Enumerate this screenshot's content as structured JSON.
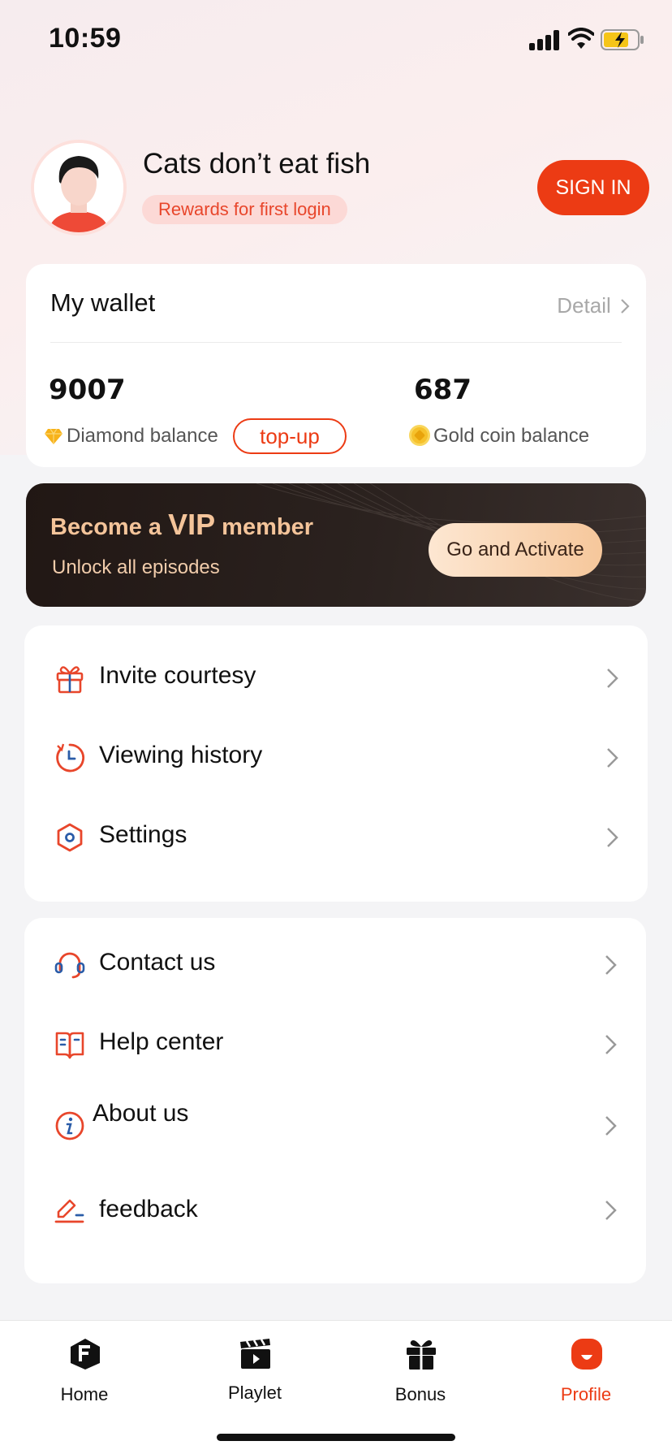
{
  "status_bar": {
    "time": "10:59"
  },
  "profile": {
    "username": "Cats don’t eat fish",
    "reward_badge": "Rewards for first login",
    "sign_in_label": "SIGN IN"
  },
  "wallet": {
    "title": "My wallet",
    "detail_label": "Detail",
    "diamond_balance": "9007",
    "diamond_label": "Diamond balance",
    "topup_label": "top-up",
    "gold_balance": "687",
    "gold_label": "Gold coin balance"
  },
  "vip": {
    "title_pre": "Become a",
    "title_vip": "VIP",
    "title_post": "member",
    "subtitle": "Unlock all episodes",
    "button_label": "Go and Activate"
  },
  "menu_primary": [
    {
      "label": "Invite courtesy",
      "icon": "gift-icon"
    },
    {
      "label": "Viewing history",
      "icon": "history-icon"
    },
    {
      "label": "Settings",
      "icon": "settings-icon"
    }
  ],
  "menu_secondary": [
    {
      "label": "Contact us",
      "icon": "headset-icon"
    },
    {
      "label": "Help center",
      "icon": "book-icon"
    },
    {
      "label": "About us",
      "icon": "info-icon"
    },
    {
      "label": "feedback",
      "icon": "edit-icon"
    }
  ],
  "bottom_nav": [
    {
      "label": "Home",
      "icon": "home-icon",
      "active": false
    },
    {
      "label": "Playlet",
      "icon": "clapper-icon",
      "active": false
    },
    {
      "label": "Bonus",
      "icon": "gift-icon",
      "active": false
    },
    {
      "label": "Profile",
      "icon": "profile-icon",
      "active": true
    }
  ],
  "colors": {
    "accent": "#ec3b14",
    "vip_gold": "#f4c49a",
    "vip_bg": "#211714"
  }
}
